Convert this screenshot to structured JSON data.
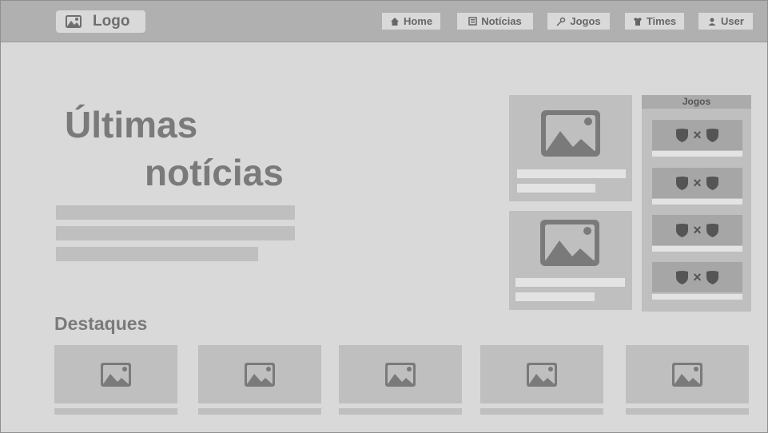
{
  "nav": {
    "logo_label": "Logo",
    "items": [
      {
        "label": "Home",
        "icon": "home-icon"
      },
      {
        "label": "Notícias",
        "icon": "newspaper-icon"
      },
      {
        "label": "Jogos",
        "icon": "ball-icon"
      },
      {
        "label": "Times",
        "icon": "shirt-icon"
      },
      {
        "label": "User",
        "icon": "user-icon"
      }
    ]
  },
  "hero": {
    "title_line1": "Últimas",
    "title_line2": "notícias"
  },
  "jogos": {
    "title": "Jogos",
    "separator": "×"
  },
  "destaques": {
    "title": "Destaques"
  },
  "colors": {
    "nav_bg": "#b0b0b0",
    "page_bg": "#d9d9d9",
    "placeholder": "#bfbfbf",
    "text": "#7a7a7a"
  }
}
